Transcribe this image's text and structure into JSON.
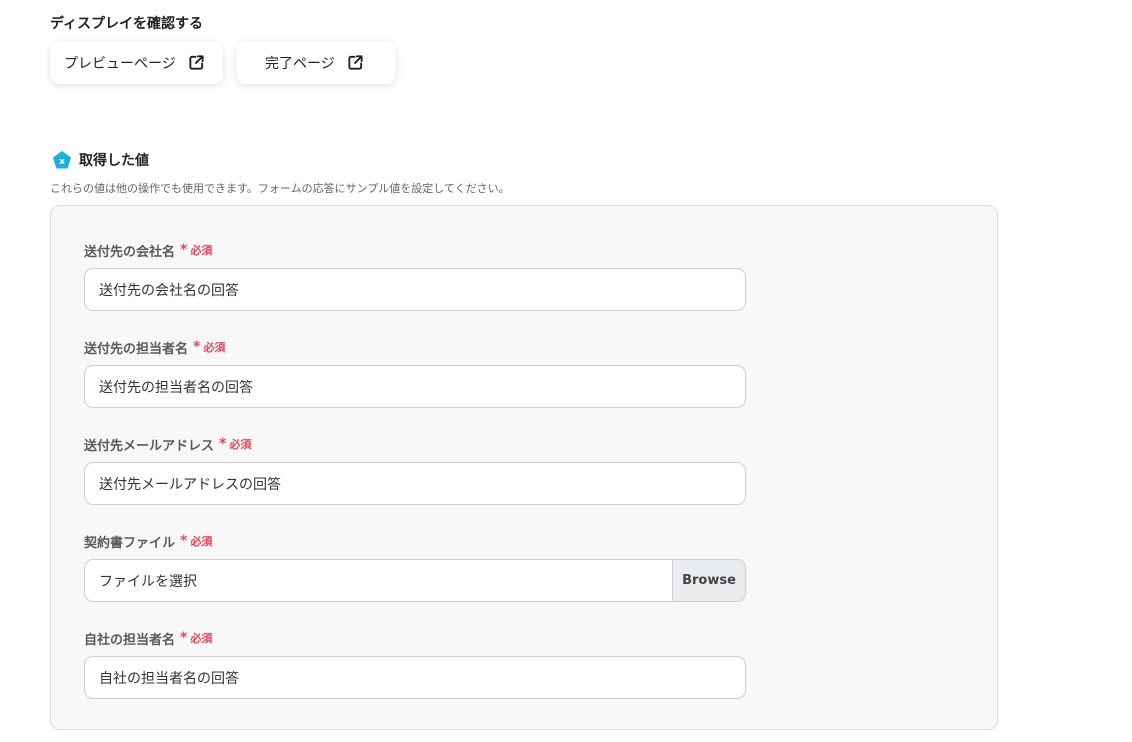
{
  "display": {
    "title": "ディスプレイを確認する",
    "buttons": [
      {
        "label": "プレビューページ",
        "icon": "external-link-icon"
      },
      {
        "label": "完了ページ",
        "icon": "external-link-icon"
      }
    ]
  },
  "section": {
    "icon": "pentagon-x-icon",
    "icon_color": "#1ab0d9",
    "title": "取得した値",
    "description": "これらの値は他の操作でも使用できます。フォームの応答にサンプル値を設定してください。"
  },
  "required_color": "#e5485b",
  "fields": [
    {
      "label": "送付先の会社名",
      "required_mark": "*",
      "required_text": "必須",
      "value": "送付先の会社名の回答"
    },
    {
      "label": "送付先の担当者名",
      "required_mark": "*",
      "required_text": "必須",
      "value": "送付先の担当者名の回答"
    },
    {
      "label": "送付先メールアドレス",
      "required_mark": "*",
      "required_text": "必須",
      "value": "送付先メールアドレスの回答"
    },
    {
      "label": "契約書ファイル",
      "required_mark": "*",
      "required_text": "必須",
      "file_placeholder": "ファイルを選択",
      "browse_label": "Browse"
    },
    {
      "label": "自社の担当者名",
      "required_mark": "*",
      "required_text": "必須",
      "value": "自社の担当者名の回答"
    }
  ]
}
